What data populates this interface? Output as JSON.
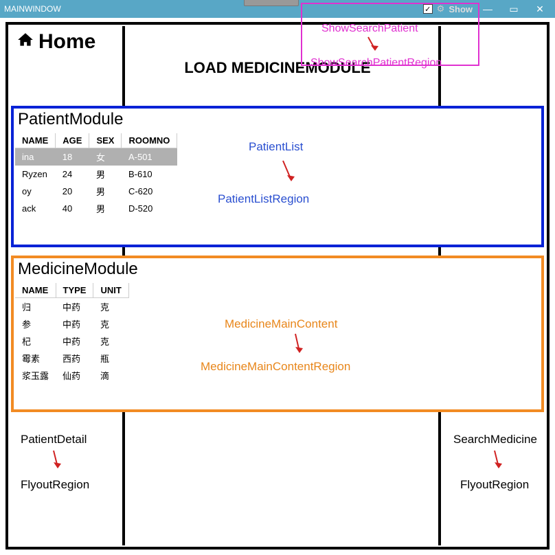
{
  "window": {
    "title": "MAINWINDOW",
    "show_label": "Show"
  },
  "header": {
    "home": "Home",
    "loadbar": "LOAD MEDICINEMODULE"
  },
  "patient": {
    "title": "PatientModule",
    "columns": [
      "NAME",
      "AGE",
      "SEX",
      "ROOMNO"
    ],
    "rows": [
      {
        "name": "ina",
        "age": "18",
        "sex": "女",
        "room": "A-501",
        "selected": true
      },
      {
        "name": "Ryzen",
        "age": "24",
        "sex": "男",
        "room": "B-610",
        "selected": false
      },
      {
        "name": "oy",
        "age": "20",
        "sex": "男",
        "room": "C-620",
        "selected": false
      },
      {
        "name": "ack",
        "age": "40",
        "sex": "男",
        "room": "D-520",
        "selected": false
      }
    ]
  },
  "medicine": {
    "title": "MedicineModule",
    "columns": [
      "NAME",
      "TYPE",
      "UNIT"
    ],
    "rows": [
      {
        "name": "归",
        "type": "中药",
        "unit": "克"
      },
      {
        "name": "参",
        "type": "中药",
        "unit": "克"
      },
      {
        "name": "杞",
        "type": "中药",
        "unit": "克"
      },
      {
        "name": "霉素",
        "type": "西药",
        "unit": "瓶"
      },
      {
        "name": "浆玉露",
        "type": "仙药",
        "unit": "滴"
      }
    ]
  },
  "annotations": {
    "showSearchPatient": "ShowSearchPatient",
    "showSearchPatientRegion": "ShowSearchPatientRegion",
    "patientList": "PatientList",
    "patientListRegion": "PatientListRegion",
    "medicineMainContent": "MedicineMainContent",
    "medicineMainContentRegion": "MedicineMainContentRegion",
    "patientDetail": "PatientDetail",
    "flyoutRegionL": "FlyoutRegion",
    "searchMedicine": "SearchMedicine",
    "flyoutRegionR": "FlyoutRegion"
  },
  "colors": {
    "titlebar": "#58a7c6",
    "blueBox": "#0522d6",
    "orangeBox": "#f28b23",
    "magenta": "#e030d0"
  }
}
